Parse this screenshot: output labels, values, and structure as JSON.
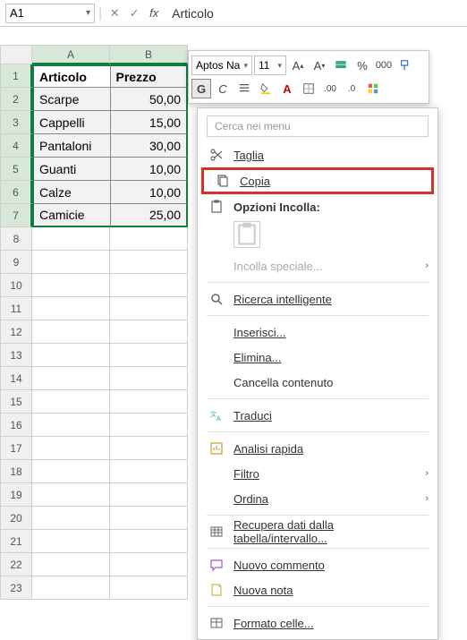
{
  "formulaBar": {
    "nameBox": "A1",
    "formulaValue": "Articolo"
  },
  "miniToolbar": {
    "font": "Aptos Na",
    "size": "11",
    "bold": "G",
    "italic": "C"
  },
  "columns": [
    "A",
    "B"
  ],
  "rows": [
    {
      "n": "1",
      "a": "Articolo",
      "b": "Prezzo",
      "header": true
    },
    {
      "n": "2",
      "a": "Scarpe",
      "b": "50,00"
    },
    {
      "n": "3",
      "a": "Cappelli",
      "b": "15,00"
    },
    {
      "n": "4",
      "a": "Pantaloni",
      "b": "30,00"
    },
    {
      "n": "5",
      "a": "Guanti",
      "b": "10,00"
    },
    {
      "n": "6",
      "a": "Calze",
      "b": "10,00"
    },
    {
      "n": "7",
      "a": "Camicie",
      "b": "25,00"
    }
  ],
  "emptyRows": [
    "8",
    "9",
    "10",
    "11",
    "12",
    "13",
    "14",
    "15",
    "16",
    "17",
    "18",
    "19",
    "20",
    "21",
    "22",
    "23"
  ],
  "ctx": {
    "searchPlaceholder": "Cerca nei menu",
    "cut": "Taglia",
    "copy": "Copia",
    "pasteOptions": "Opzioni Incolla:",
    "pasteSpecial": "Incolla speciale...",
    "smartLookup": "Ricerca intelligente",
    "insert": "Inserisci...",
    "delete": "Elimina...",
    "clear": "Cancella contenuto",
    "translate": "Traduci",
    "quickAnalysis": "Analisi rapida",
    "filter": "Filtro",
    "sort": "Ordina",
    "getData": "Recupera dati dalla tabella/intervallo...",
    "newComment": "Nuovo commento",
    "newNote": "Nuova nota",
    "formatCells": "Formato celle..."
  }
}
